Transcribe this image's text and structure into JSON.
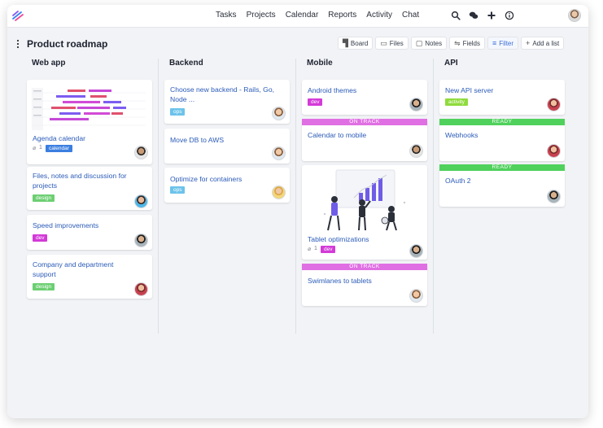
{
  "nav": {
    "items": [
      "Tasks",
      "Projects",
      "Calendar",
      "Reports",
      "Activity",
      "Chat"
    ]
  },
  "header_icons": [
    "search-icon",
    "chat-bubbles-icon",
    "plus-icon",
    "info-icon"
  ],
  "board": {
    "title": "Product roadmap",
    "tools": [
      {
        "icon": "board-icon",
        "label": "Board"
      },
      {
        "icon": "folder-icon",
        "label": "Files"
      },
      {
        "icon": "notes-icon",
        "label": "Notes"
      },
      {
        "icon": "fields-icon",
        "label": "Fields"
      },
      {
        "icon": "filter-icon",
        "label": "Filter"
      },
      {
        "icon": "plus-icon",
        "label": "Add a list"
      }
    ]
  },
  "columns": [
    {
      "title": "Web app",
      "cards": [
        {
          "title": "Agenda calendar",
          "attachments": "1",
          "tag": "calendar"
        },
        {
          "title_lines": [
            "Files, notes and discussion for",
            "projects"
          ],
          "tag": "design"
        },
        {
          "title": "Speed improvements",
          "tag": "dev"
        },
        {
          "title_lines": [
            "Company and department",
            "support"
          ],
          "tag": "design"
        }
      ]
    },
    {
      "title": "Backend",
      "cards": [
        {
          "title_lines": [
            "Choose new backend - Rails, Go,",
            "Node ..."
          ],
          "tag": "ops"
        },
        {
          "title": "Move DB to AWS"
        },
        {
          "title": "Optimize for containers",
          "tag": "ops"
        }
      ]
    },
    {
      "title": "Mobile",
      "cards": [
        {
          "title": "Android themes",
          "tag": "dev"
        },
        {
          "status": "ON TRACK",
          "title": "Calendar to mobile"
        },
        {
          "title": "Tablet optimizations",
          "attachments": "1",
          "tag": "dev"
        },
        {
          "status": "ON TRACK",
          "title": "Swimlanes to tablets"
        }
      ]
    },
    {
      "title": "API",
      "cards": [
        {
          "title": "New API server",
          "tag": "activity"
        },
        {
          "status": "READY",
          "title": "Webhooks"
        },
        {
          "status": "READY",
          "title": "OAuth 2"
        }
      ]
    }
  ],
  "colors": {
    "calendar": "#3b7fe0",
    "design": "#6ccf72",
    "dev": "#d33ad8",
    "ops": "#6cc3ea",
    "activity": "#8fdb3c",
    "on_track": "#e06fe3",
    "ready": "#4fd15c",
    "link": "#2b5bb8"
  }
}
